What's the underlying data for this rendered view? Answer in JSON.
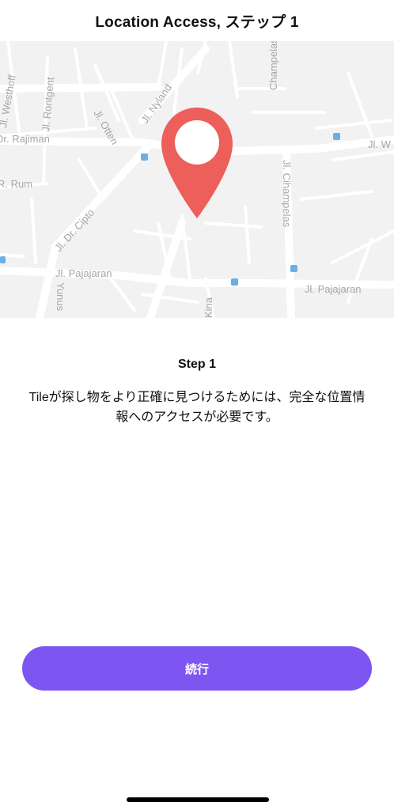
{
  "header": {
    "title": "Location Access, ステップ 1"
  },
  "map": {
    "labels": {
      "westhoff": "Jl. Westhoff",
      "rontgent": "Jl. Rontgent",
      "otten": "Jl. Otten",
      "nyland": "Jl. Nyland",
      "champelas_top": "Champelas",
      "rajiman": "Dr. Rajiman",
      "rum": "R. Rum",
      "wastu": "Jl. W",
      "cipto": "Jl. Dr. Cipto",
      "cihampelas": "Jl. Cihampelas",
      "pajajaran_left": "Jl. Pajajaran",
      "pajajaran_right": "Jl. Pajajaran",
      "yunus": "Yunus",
      "kina": "Kina"
    },
    "pin_color": "#ec5f5a"
  },
  "step": {
    "title": "Step 1",
    "description": "Tileが探し物をより正確に見つけるためには、完全な位置情報へのアクセスが必要です。"
  },
  "continue_button": {
    "label": "続行",
    "color": "#7d56f2"
  }
}
